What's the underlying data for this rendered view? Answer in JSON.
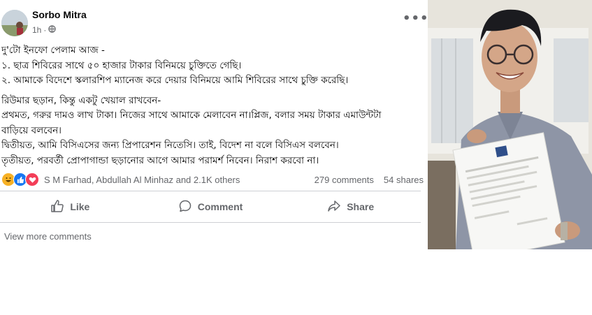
{
  "post": {
    "author": "Sorbo Mitra",
    "time": "1h",
    "privacy_icon": "globe-icon",
    "menu_icon": "more-dots-icon",
    "lines": [
      "দু'টো ইনফো পেলাম আজ -",
      "১. ছাত্র শিবিরের সাথে ৫০ হাজার টাকার বিনিময়ে চুক্তিতে গেছি।",
      "২. আমাকে বিদেশে স্কলারশিপ ম্যানেজ করে দেয়ার বিনিময়ে আমি শিবিরের সাথে চুক্তি করেছি।",
      "রিউমার ছড়ান, কিন্তু একটু খেয়াল রাখবেন-",
      "প্রথমত, গরুর দামও লাখ টাকা। নিজের সাথে আমাকে মেলাবেন না।প্লিজ, বলার সময় টাকার এমাউন্টটা",
      "বাড়িয়ে বলবেন।",
      "দ্বিতীয়ত, আমি বিসিএসের জন্য প্রিপারেশন নিতেসি। তাই, বিদেশ না বলে বিসিএস বলবেন।",
      "তৃতীয়ত, পরবর্তী প্রোপাগান্ডা ছড়ানোর আগে আমার পরামর্শ নিবেন। নিরাশ করবো না।"
    ],
    "reactions": {
      "icons": [
        "haha-icon",
        "like-icon",
        "love-icon"
      ],
      "names": "S M Farhad, Abdullah Al Minhaz and 2.1K others",
      "comments": "279 comments",
      "shares": "54 shares"
    },
    "actions": {
      "like": "Like",
      "comment": "Comment",
      "share": "Share"
    },
    "view_more": "View more comments"
  },
  "colors": {
    "secondary_text": "#65676b",
    "divider": "#ced0d4",
    "like_blue": "#1877f2",
    "love_red": "#f33e58",
    "haha_yellow": "#f7b125"
  }
}
